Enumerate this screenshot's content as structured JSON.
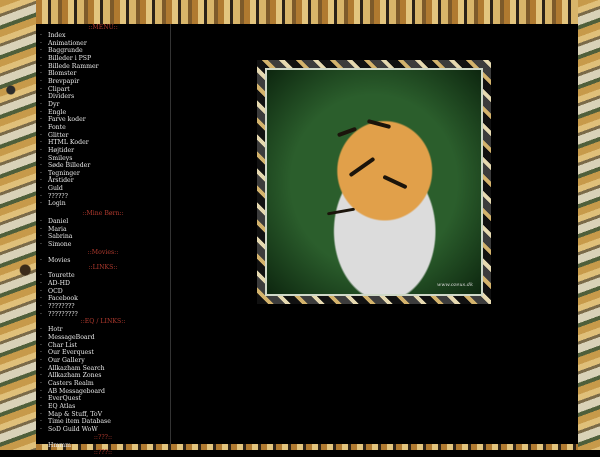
{
  "menu": {
    "title": "::MENU::",
    "items": [
      "Index",
      "Animationer",
      "Baggrunde",
      "Billeder i PSP",
      "Billede Rammer",
      "Blomster",
      "Brevpapir",
      "Clipart",
      "Dividers",
      "Dyr",
      "Engle",
      "Farve koder",
      "Fonte",
      "Glitter",
      "HTML Koder",
      "Højtider",
      "Smileys",
      "Søde Billeder",
      "Tegninger",
      "Årstider",
      "Guld",
      "??????",
      "Login"
    ]
  },
  "mine_born": {
    "title": "::Mine Børn::",
    "items": [
      "Daniel",
      "Maria",
      "Sabrina",
      "Simone"
    ]
  },
  "movies": {
    "title": "::Movies::",
    "items": [
      "Movies"
    ]
  },
  "links": {
    "title": "::LINKS::",
    "items": [
      "Tourette",
      "AD-HD",
      "OCD",
      "Facebook",
      "????????",
      "?????????"
    ]
  },
  "eq_links": {
    "title": "::EQ / LINKS::",
    "items": [
      "Hotr",
      "MessageBoard",
      "Char List",
      "Our Everquest",
      "Our Gallery",
      "Allkazham Search",
      "Allkazham Zones",
      "Casters Realm",
      "AB Messageboard",
      "EverQuest",
      "EQ Atlas",
      "Map & Stuff, ToV",
      "Time item Database",
      "SoD Guild WoW"
    ]
  },
  "misc": {
    "title": "::???::",
    "items": [
      "Hmmm"
    ]
  },
  "misc2": {
    "title": "::???::"
  },
  "image": {
    "watermark": "www.ozeus.dk"
  }
}
